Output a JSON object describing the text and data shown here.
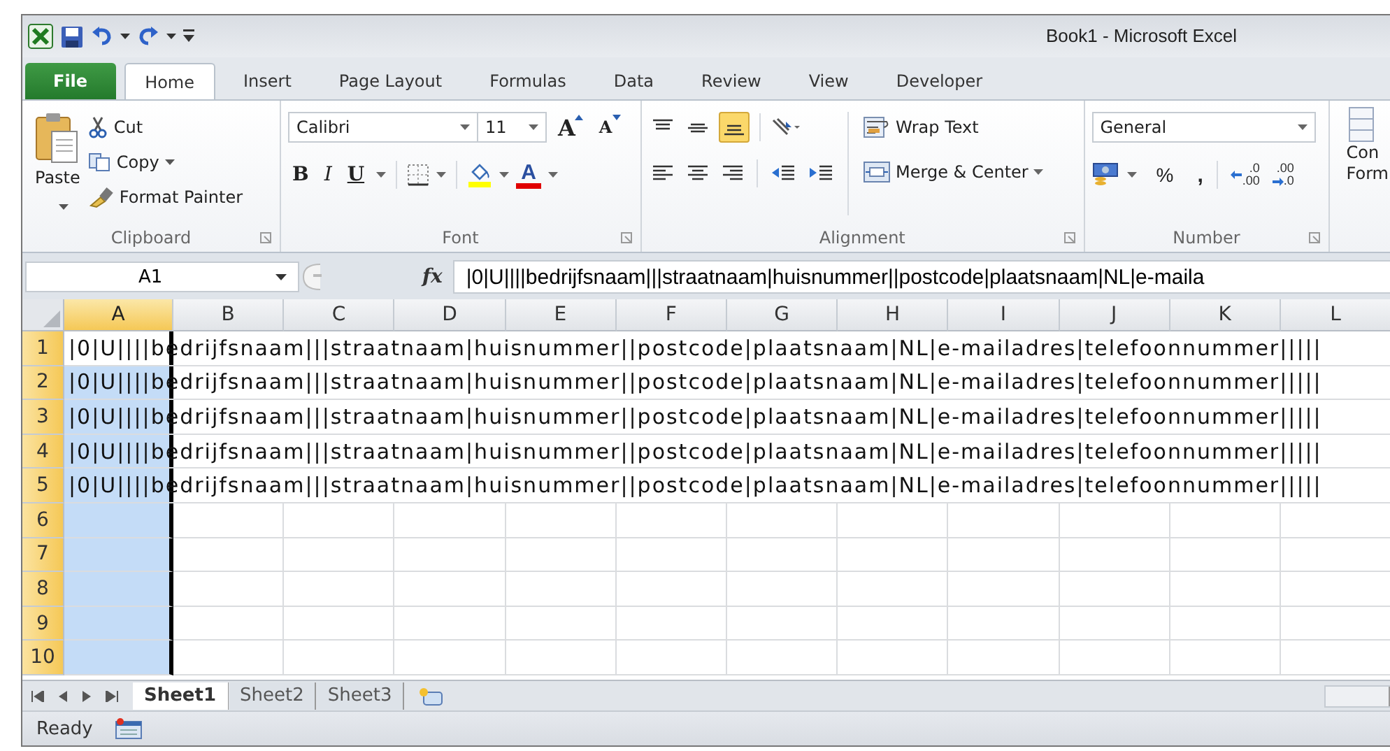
{
  "window": {
    "title": "Book1  -  Microsoft Excel"
  },
  "ribbon_tabs": [
    {
      "label": "File",
      "kind": "file",
      "selected": false
    },
    {
      "label": "Home",
      "kind": "tab",
      "selected": true
    },
    {
      "label": "Insert",
      "kind": "tab",
      "selected": false
    },
    {
      "label": "Page Layout",
      "kind": "tab",
      "selected": false
    },
    {
      "label": "Formulas",
      "kind": "tab",
      "selected": false
    },
    {
      "label": "Data",
      "kind": "tab",
      "selected": false
    },
    {
      "label": "Review",
      "kind": "tab",
      "selected": false
    },
    {
      "label": "View",
      "kind": "tab",
      "selected": false
    },
    {
      "label": "Developer",
      "kind": "tab",
      "selected": false
    }
  ],
  "clipboard": {
    "label": "Clipboard",
    "paste": "Paste",
    "cut": "Cut",
    "copy": "Copy",
    "format_painter": "Format Painter"
  },
  "font": {
    "label": "Font",
    "name": "Calibri",
    "size": "11",
    "grow": "A",
    "shrink": "A",
    "bold": "B",
    "italic": "I",
    "underline": "U",
    "font_color": "A"
  },
  "alignment": {
    "label": "Alignment",
    "bottom_align_selected": true,
    "wrap_text": "Wrap Text",
    "merge_center": "Merge & Center"
  },
  "number": {
    "label": "Number",
    "format": "General",
    "percent": "%",
    "comma": ",",
    "increase_decimal": [
      ".0",
      ".00"
    ],
    "decrease_decimal": [
      ".00",
      ".0"
    ]
  },
  "styles": {
    "conditional_formatting": [
      "Con",
      "Form"
    ]
  },
  "formula_bar": {
    "name_box": "A1",
    "function_label": "fx",
    "formula": "|0|U||||bedrijfsnaam|||straatnaam|huisnummer||postcode|plaatsnaam|NL|e-maila"
  },
  "columns": [
    {
      "label": "A",
      "selected": true
    },
    {
      "label": "B",
      "selected": false
    },
    {
      "label": "C",
      "selected": false
    },
    {
      "label": "D",
      "selected": false
    },
    {
      "label": "E",
      "selected": false
    },
    {
      "label": "F",
      "selected": false
    },
    {
      "label": "G",
      "selected": false
    },
    {
      "label": "H",
      "selected": false
    },
    {
      "label": "I",
      "selected": false
    },
    {
      "label": "J",
      "selected": false
    },
    {
      "label": "K",
      "selected": false
    },
    {
      "label": "L",
      "selected": false
    }
  ],
  "rows": [
    {
      "label": "1",
      "active": true,
      "value": "|0|U||||bedrijfsnaam|||straatnaam|huisnummer||postcode|plaatsnaam|NL|e-mailadres|telefoonnummer|||||"
    },
    {
      "label": "2",
      "active": false,
      "value": "|0|U||||bedrijfsnaam|||straatnaam|huisnummer||postcode|plaatsnaam|NL|e-mailadres|telefoonnummer|||||"
    },
    {
      "label": "3",
      "active": false,
      "value": "|0|U||||bedrijfsnaam|||straatnaam|huisnummer||postcode|plaatsnaam|NL|e-mailadres|telefoonnummer|||||"
    },
    {
      "label": "4",
      "active": false,
      "value": "|0|U||||bedrijfsnaam|||straatnaam|huisnummer||postcode|plaatsnaam|NL|e-mailadres|telefoonnummer|||||"
    },
    {
      "label": "5",
      "active": false,
      "value": "|0|U||||bedrijfsnaam|||straatnaam|huisnummer||postcode|plaatsnaam|NL|e-mailadres|telefoonnummer|||||"
    },
    {
      "label": "6",
      "active": false
    },
    {
      "label": "7",
      "active": false
    },
    {
      "label": "8",
      "active": false
    },
    {
      "label": "9",
      "active": false
    },
    {
      "label": "10",
      "active": false
    }
  ],
  "sheet_tabs": [
    {
      "label": "Sheet1",
      "selected": true
    },
    {
      "label": "Sheet2",
      "selected": false
    },
    {
      "label": "Sheet3",
      "selected": false
    }
  ],
  "status_bar": {
    "text": "Ready"
  }
}
